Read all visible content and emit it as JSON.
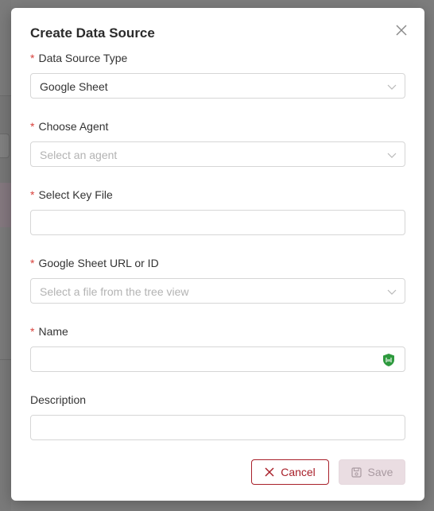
{
  "modal": {
    "title": "Create Data Source",
    "fields": {
      "data_source_type": {
        "label": "Data Source Type",
        "required": "*",
        "value": "Google Sheet"
      },
      "agent": {
        "label": "Choose Agent",
        "required": "*",
        "placeholder": "Select an agent"
      },
      "key_file": {
        "label": "Select Key File",
        "required": "*",
        "value": ""
      },
      "sheet_url": {
        "label": "Google Sheet URL or ID",
        "required": "*",
        "placeholder": "Select a file from the tree view"
      },
      "name": {
        "label": "Name",
        "required": "*",
        "value": ""
      },
      "description": {
        "label": "Description",
        "value": ""
      }
    },
    "buttons": {
      "cancel": "Cancel",
      "save": "Save"
    }
  },
  "colors": {
    "required": "#d8413b",
    "cancel_accent": "#a8202a",
    "save_disabled_bg": "#eadde2",
    "shield_green": "#2e9a3e"
  },
  "icons": {
    "close": "close-icon",
    "caret": "chevron-down-icon",
    "password_manager": "shield-icon",
    "cancel": "x-icon",
    "save": "save-icon"
  }
}
